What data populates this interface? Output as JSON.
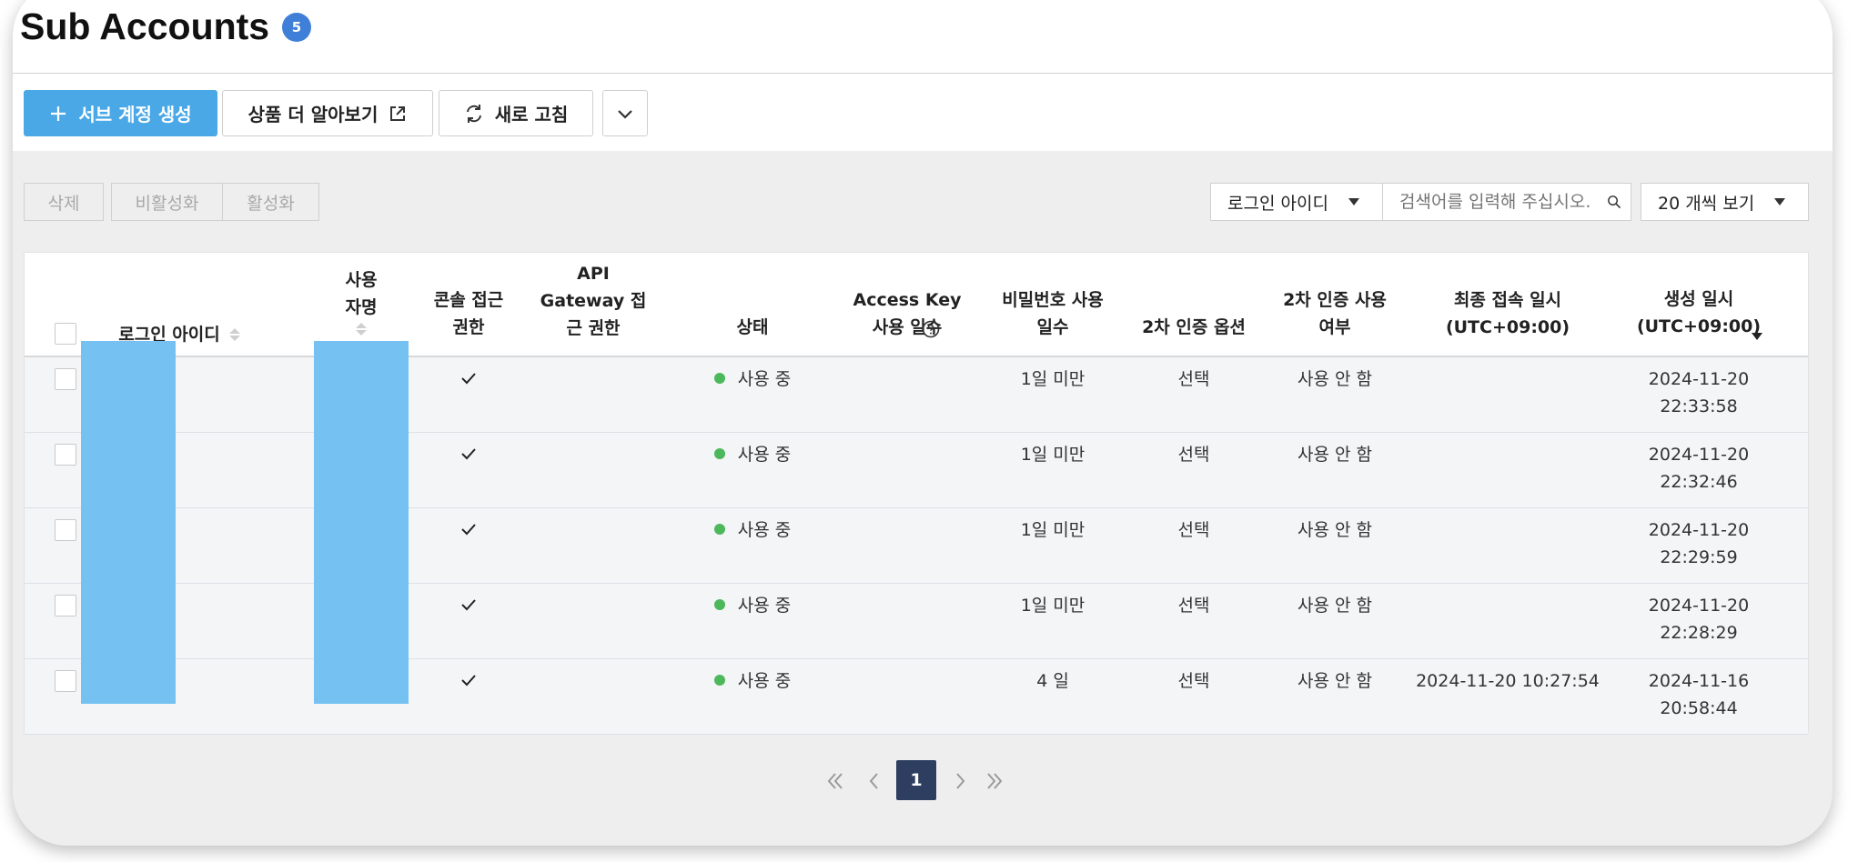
{
  "header": {
    "title": "Sub Accounts",
    "count_badge": "5"
  },
  "toolbar": {
    "create_label": "서브 계정 생성",
    "learn_more_label": "상품 더 알아보기",
    "refresh_label": "새로 고침"
  },
  "actions": {
    "delete_label": "삭제",
    "deactivate_label": "비활성화",
    "activate_label": "활성화"
  },
  "filters": {
    "search_field": "로그인 아이디",
    "search_placeholder": "검색어를 입력해 주십시오.",
    "page_size": "20 개씩 보기"
  },
  "table": {
    "columns": [
      "로그인 아이디",
      "사용\n자명",
      "콘솔 접근\n권한",
      "API\nGateway 접\n근 권한",
      "상태",
      "Access Key\n사용 일수",
      "비밀번호 사용\n일수",
      "2차 인증 옵션",
      "2차 인증 사용\n여부",
      "최종 접속 일시\n(UTC+09:00)",
      "생성 일시\n(UTC+09:00)"
    ],
    "rows": [
      {
        "status": "사용 중",
        "password_days": "1일 미만",
        "mfa_option": "선택",
        "mfa_used": "사용 안 함",
        "last_login": "",
        "created": "2024-11-20\n22:33:58"
      },
      {
        "status": "사용 중",
        "password_days": "1일 미만",
        "mfa_option": "선택",
        "mfa_used": "사용 안 함",
        "last_login": "",
        "created": "2024-11-20\n22:32:46"
      },
      {
        "status": "사용 중",
        "password_days": "1일 미만",
        "mfa_option": "선택",
        "mfa_used": "사용 안 함",
        "last_login": "",
        "created": "2024-11-20\n22:29:59"
      },
      {
        "status": "사용 중",
        "password_days": "1일 미만",
        "mfa_option": "선택",
        "mfa_used": "사용 안 함",
        "last_login": "",
        "created": "2024-11-20\n22:28:29"
      },
      {
        "status": "사용 중",
        "password_days": "4 일",
        "mfa_option": "선택",
        "mfa_used": "사용 안 함",
        "last_login": "2024-11-20 10:27:54",
        "created": "2024-11-16\n20:58:44"
      }
    ]
  },
  "pagination": {
    "current_page": "1"
  },
  "colors": {
    "primary": "#4aa8e6",
    "badge": "#3f7fd8",
    "status_active": "#4cb85b",
    "redaction": "#74c1f2",
    "page_current": "#2d3e61"
  }
}
